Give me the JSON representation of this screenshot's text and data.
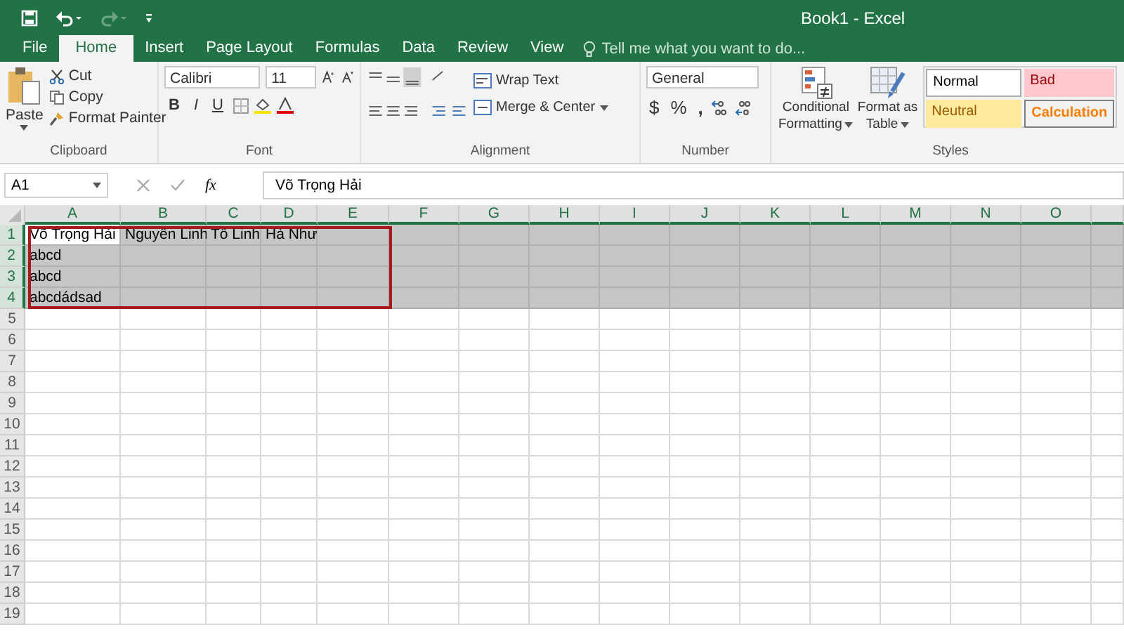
{
  "window": {
    "title": "Book1 - Excel"
  },
  "tabs": [
    {
      "label": "File",
      "selected": false
    },
    {
      "label": "Home",
      "selected": true
    },
    {
      "label": "Insert",
      "selected": false
    },
    {
      "label": "Page Layout",
      "selected": false
    },
    {
      "label": "Formulas",
      "selected": false
    },
    {
      "label": "Data",
      "selected": false
    },
    {
      "label": "Review",
      "selected": false
    },
    {
      "label": "View",
      "selected": false
    }
  ],
  "tell_me": {
    "placeholder": "Tell me what you want to do..."
  },
  "clipboard": {
    "paste": "Paste",
    "cut": "Cut",
    "copy": "Copy",
    "format_painter": "Format Painter",
    "label": "Clipboard"
  },
  "font": {
    "name": "Calibri",
    "size": "11",
    "bold": "B",
    "italic": "I",
    "underline": "U",
    "label": "Font"
  },
  "alignment": {
    "wrap": "Wrap Text",
    "merge": "Merge & Center",
    "label": "Alignment"
  },
  "number": {
    "format": "General",
    "currency": "$",
    "percent": "%",
    "comma": ",",
    "label": "Number"
  },
  "styles": {
    "conditional": [
      "Conditional",
      "Formatting"
    ],
    "format_table": [
      "Format as",
      "Table"
    ],
    "cells": [
      {
        "kind": "normal",
        "text": "Normal"
      },
      {
        "kind": "bad",
        "text": "Bad"
      },
      {
        "kind": "neutral",
        "text": "Neutral"
      },
      {
        "kind": "calc",
        "text": "Calculation"
      }
    ],
    "label": "Styles"
  },
  "formula_bar": {
    "name_box": "A1",
    "fx": "fx",
    "value": "Võ Trọng Hải"
  },
  "columns": [
    "A",
    "B",
    "C",
    "D",
    "E",
    "F",
    "G",
    "H",
    "I",
    "J",
    "K",
    "L",
    "M",
    "N",
    "O"
  ],
  "rows": [
    {
      "number": "1",
      "selected": true,
      "cells": [
        {
          "text": "Võ Trọng Hải",
          "active": true
        },
        {
          "text": "Nguyễn Linh",
          "active": false
        },
        {
          "text": "Tố Linh",
          "active": false
        },
        {
          "text": "Hà Như",
          "active": false
        }
      ]
    },
    {
      "number": "2",
      "selected": true,
      "cells": [
        {
          "text": "abcd",
          "active": false
        }
      ]
    },
    {
      "number": "3",
      "selected": true,
      "cells": [
        {
          "text": "abcd",
          "active": false
        }
      ]
    },
    {
      "number": "4",
      "selected": true,
      "cells": [
        {
          "text": "abcdádsad",
          "active": false
        }
      ]
    },
    {
      "number": "5",
      "selected": false,
      "cells": []
    },
    {
      "number": "6",
      "selected": false,
      "cells": []
    },
    {
      "number": "7",
      "selected": false,
      "cells": []
    },
    {
      "number": "8",
      "selected": false,
      "cells": []
    },
    {
      "number": "9",
      "selected": false,
      "cells": []
    },
    {
      "number": "10",
      "selected": false,
      "cells": []
    },
    {
      "number": "11",
      "selected": false,
      "cells": []
    },
    {
      "number": "12",
      "selected": false,
      "cells": []
    },
    {
      "number": "13",
      "selected": false,
      "cells": []
    },
    {
      "number": "14",
      "selected": false,
      "cells": []
    },
    {
      "number": "15",
      "selected": false,
      "cells": []
    },
    {
      "number": "16",
      "selected": false,
      "cells": []
    },
    {
      "number": "17",
      "selected": false,
      "cells": []
    },
    {
      "number": "18",
      "selected": false,
      "cells": []
    },
    {
      "number": "19",
      "selected": false,
      "cells": []
    }
  ]
}
